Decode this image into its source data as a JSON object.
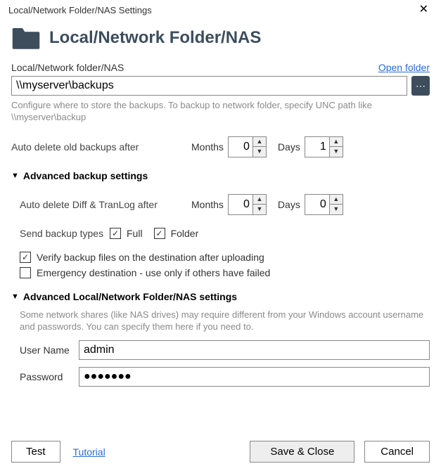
{
  "window": {
    "title": "Local/Network Folder/NAS Settings"
  },
  "header": {
    "title": "Local/Network Folder/NAS"
  },
  "path": {
    "label": "Local/Network folder/NAS",
    "open_link": "Open folder",
    "value": "\\\\myserver\\backups",
    "hint": "Configure where to store the backups. To backup to network folder, specify UNC path like \\\\myserver\\backup"
  },
  "auto_delete": {
    "label": "Auto delete old backups after",
    "months_label": "Months",
    "months": "0",
    "days_label": "Days",
    "days": "1"
  },
  "adv_backup": {
    "title": "Advanced backup settings",
    "diff_label": "Auto delete Diff & TranLog after",
    "months_label": "Months",
    "months": "0",
    "days_label": "Days",
    "days": "0",
    "send_label": "Send backup types",
    "full_label": "Full",
    "full_checked": true,
    "folder_label": "Folder",
    "folder_checked": true,
    "verify_label": "Verify backup files on the destination after uploading",
    "verify_checked": true,
    "emergency_label": "Emergency destination - use only if others have failed",
    "emergency_checked": false
  },
  "adv_nas": {
    "title": "Advanced Local/Network Folder/NAS settings",
    "hint": "Some network shares (like NAS drives) may require different from your Windows account username and passwords. You can specify them here if you need to.",
    "user_label": "User Name",
    "user_value": "admin",
    "pass_label": "Password",
    "pass_value": "●●●●●●●"
  },
  "footer": {
    "test": "Test",
    "tutorial": "Tutorial",
    "save": "Save & Close",
    "cancel": "Cancel"
  }
}
